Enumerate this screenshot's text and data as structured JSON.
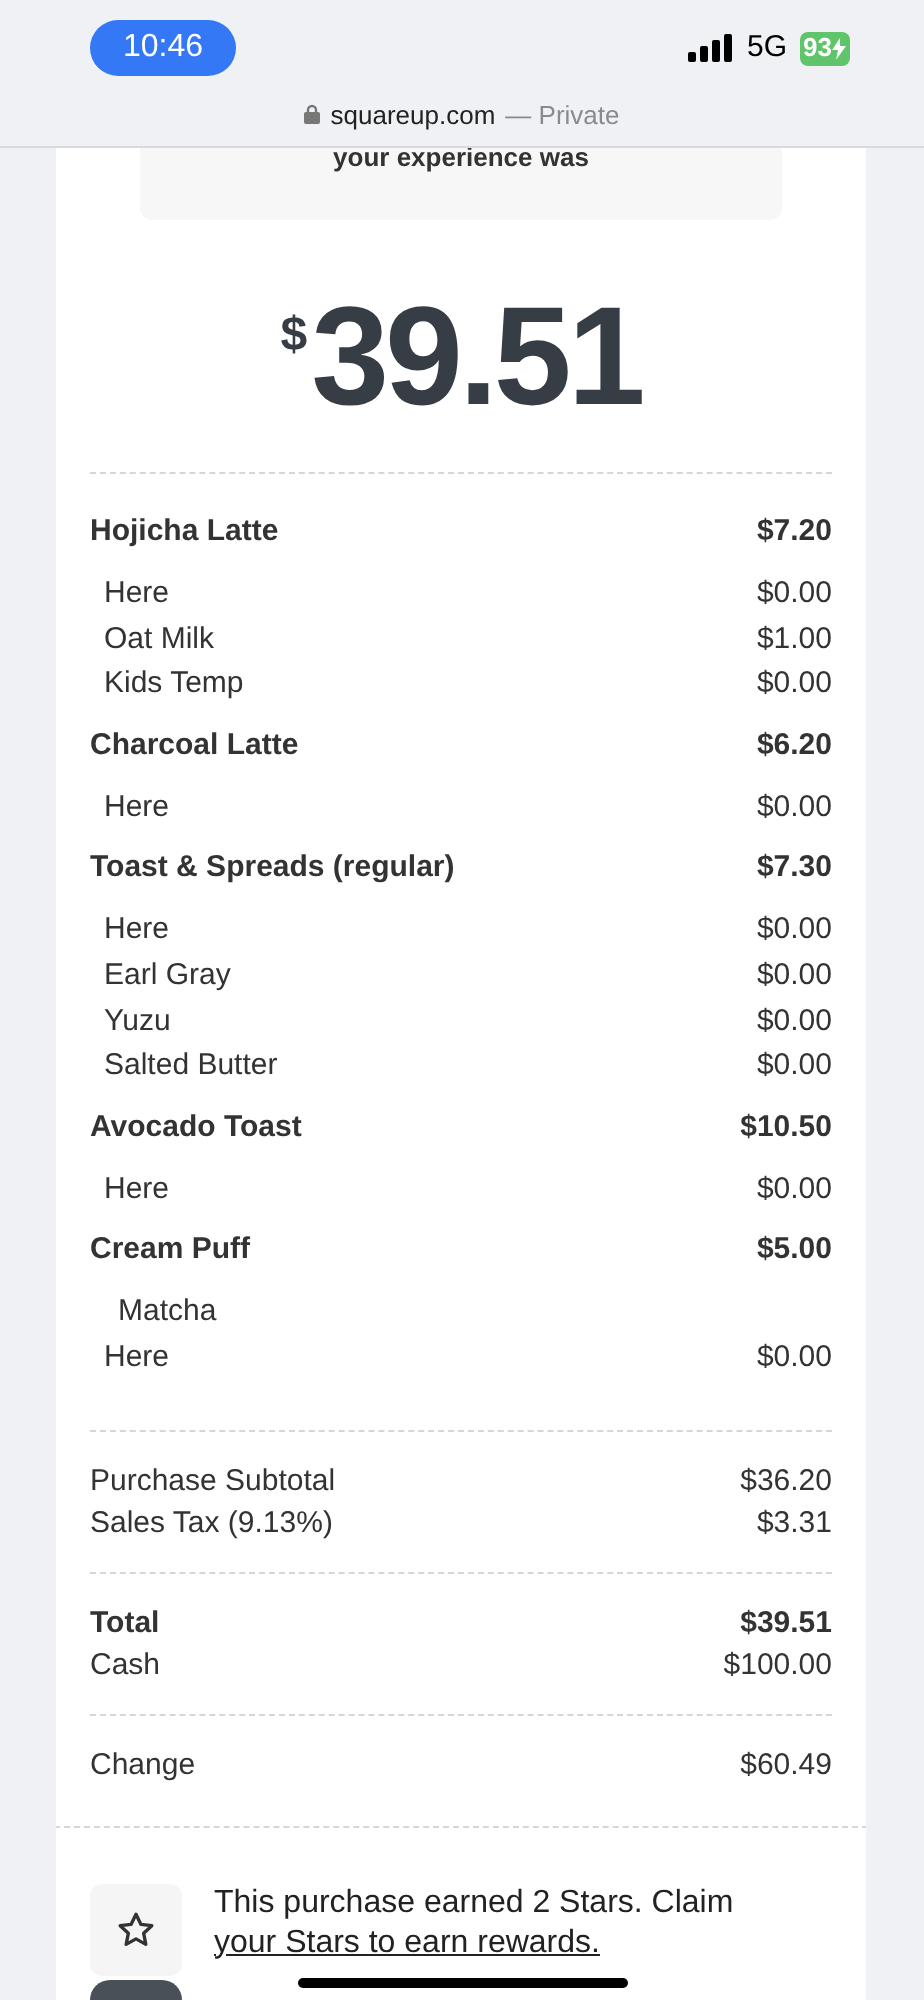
{
  "status_bar": {
    "time": "10:46",
    "network": "5G",
    "battery": "93"
  },
  "url_bar": {
    "domain": "squareup.com",
    "mode": "— Private"
  },
  "feedback": {
    "text": "your experience was"
  },
  "amount": {
    "currency": "$",
    "value": "39.51"
  },
  "items": [
    {
      "name": "Hojicha Latte",
      "price": "$7.20",
      "modifiers": [
        {
          "kind": "option",
          "name": "Here",
          "price": "$0.00"
        },
        {
          "kind": "option",
          "name": "Oat Milk",
          "price": "$1.00"
        },
        {
          "kind": "option",
          "name": "Kids Temp",
          "price": "$0.00"
        }
      ]
    },
    {
      "name": "Charcoal Latte",
      "price": "$6.20",
      "modifiers": [
        {
          "kind": "option",
          "name": "Here",
          "price": "$0.00"
        }
      ]
    },
    {
      "name": "Toast & Spreads (regular)",
      "price": "$7.30",
      "modifiers": [
        {
          "kind": "option",
          "name": "Here",
          "price": "$0.00"
        },
        {
          "kind": "option",
          "name": "Earl Gray",
          "price": "$0.00"
        },
        {
          "kind": "option",
          "name": "Yuzu",
          "price": "$0.00"
        },
        {
          "kind": "option",
          "name": "Salted Butter",
          "price": "$0.00"
        }
      ]
    },
    {
      "name": "Avocado Toast",
      "price": "$10.50",
      "modifiers": [
        {
          "kind": "option",
          "name": "Here",
          "price": "$0.00"
        }
      ]
    },
    {
      "name": "Cream Puff",
      "price": "$5.00",
      "modifiers": [
        {
          "kind": "note",
          "name": "Matcha"
        },
        {
          "kind": "option",
          "name": "Here",
          "price": "$0.00"
        }
      ]
    }
  ],
  "summary": [
    [
      {
        "label": "Purchase Subtotal",
        "value": "$36.20",
        "bold": false
      },
      {
        "label": "Sales Tax (9.13%)",
        "value": "$3.31",
        "bold": false
      }
    ],
    [
      {
        "label": "Total",
        "value": "$39.51",
        "bold": true
      },
      {
        "label": "Cash",
        "value": "$100.00",
        "bold": false
      }
    ],
    [
      {
        "label": "Change",
        "value": "$60.49",
        "bold": false
      }
    ]
  ],
  "rewards": {
    "text": "This purchase earned 2 Stars. Claim",
    "link": "your Stars to earn rewards."
  }
}
